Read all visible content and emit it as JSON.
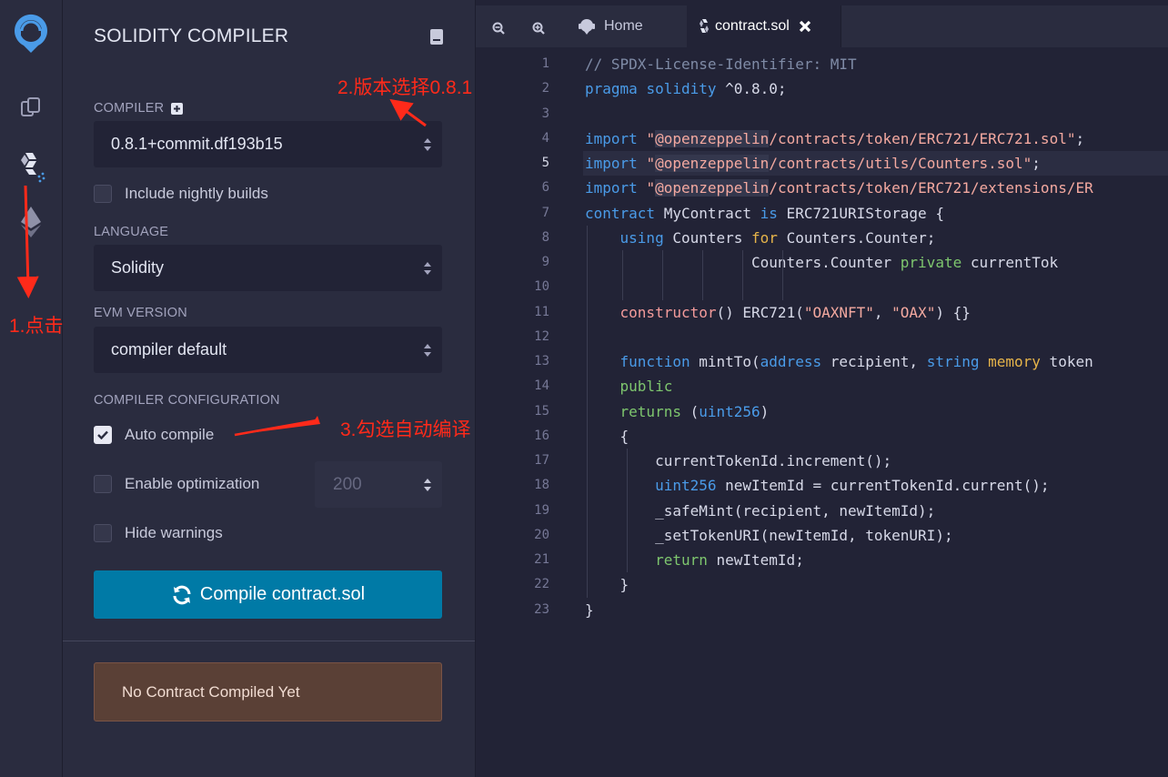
{
  "rail": {
    "icons": [
      "remix-logo-icon",
      "file-explorer-icon",
      "solidity-compiler-icon",
      "deploy-run-icon"
    ]
  },
  "panel": {
    "title": "SOLIDITY COMPILER",
    "compiler": {
      "label": "COMPILER",
      "value": "0.8.1+commit.df193b15"
    },
    "nightly_label": "Include nightly builds",
    "language": {
      "label": "LANGUAGE",
      "value": "Solidity"
    },
    "evm": {
      "label": "EVM VERSION",
      "value": "compiler default"
    },
    "config_label": "COMPILER CONFIGURATION",
    "auto_compile": {
      "label": "Auto compile",
      "checked": true
    },
    "optimization": {
      "label": "Enable optimization",
      "checked": false,
      "runs": "200"
    },
    "hide_warnings": {
      "label": "Hide warnings",
      "checked": false
    },
    "compile_button": "Compile contract.sol",
    "status": "No Contract Compiled Yet"
  },
  "annotations": {
    "step1": "1.点击",
    "step2": "2.版本选择0.8.1",
    "step3": "3.勾选自动编译"
  },
  "editor": {
    "tabs": [
      {
        "label": "Home",
        "active": false
      },
      {
        "label": "contract.sol",
        "active": true
      }
    ],
    "current_line": 5,
    "lines": [
      {
        "n": "1",
        "parts": [
          [
            "c-com",
            "// SPDX-License-Identifier: MIT"
          ]
        ]
      },
      {
        "n": "2",
        "parts": [
          [
            "c-kw",
            "pragma"
          ],
          [
            "",
            " "
          ],
          [
            "c-kw",
            "solidity"
          ],
          [
            "",
            " ^0.8.0;"
          ]
        ]
      },
      {
        "n": "3",
        "parts": []
      },
      {
        "n": "4",
        "parts": [
          [
            "c-kw",
            "import"
          ],
          [
            "",
            " "
          ],
          [
            "c-str",
            "\""
          ],
          [
            "c-str c-hl",
            "@openzeppelin"
          ],
          [
            "c-str",
            "/contracts/token/ERC721/ERC721.sol\""
          ],
          [
            "",
            ";"
          ]
        ]
      },
      {
        "n": "5",
        "parts": [
          [
            "c-kw",
            "import"
          ],
          [
            "",
            " "
          ],
          [
            "c-str",
            "\""
          ],
          [
            "c-str c-hl",
            "@openzeppelin"
          ],
          [
            "c-str",
            "/contracts/utils/Counters.sol\""
          ],
          [
            "",
            ";"
          ]
        ]
      },
      {
        "n": "6",
        "parts": [
          [
            "c-kw",
            "import"
          ],
          [
            "",
            " "
          ],
          [
            "c-str",
            "\""
          ],
          [
            "c-str c-hl",
            "@openzeppelin"
          ],
          [
            "c-str",
            "/contracts/token/ERC721/extensions/ER"
          ]
        ]
      },
      {
        "n": "7",
        "parts": [
          [
            "c-kw",
            "contract"
          ],
          [
            "",
            " MyContract "
          ],
          [
            "c-kw",
            "is"
          ],
          [
            "",
            " ERC721URIStorage {"
          ]
        ]
      },
      {
        "n": "8",
        "parts": [
          [
            "",
            "    "
          ],
          [
            "c-kw",
            "using"
          ],
          [
            "",
            " Counters "
          ],
          [
            "c-mem",
            "for"
          ],
          [
            "",
            " Counters.Counter;"
          ]
        ]
      },
      {
        "n": "9",
        "parts": [
          [
            "",
            "                   Counters.Counter "
          ],
          [
            "c-pv",
            "private"
          ],
          [
            "",
            " currentTok"
          ]
        ]
      },
      {
        "n": "10",
        "parts": []
      },
      {
        "n": "11",
        "parts": [
          [
            "",
            "    "
          ],
          [
            "c-fn",
            "constructor"
          ],
          [
            "",
            "() ERC721("
          ],
          [
            "c-str",
            "\"OAXNFT\""
          ],
          [
            "",
            ", "
          ],
          [
            "c-str",
            "\"OAX\""
          ],
          [
            "",
            ") {}"
          ]
        ]
      },
      {
        "n": "12",
        "parts": []
      },
      {
        "n": "13",
        "parts": [
          [
            "",
            "    "
          ],
          [
            "c-kw",
            "function"
          ],
          [
            "",
            " mintTo("
          ],
          [
            "c-kw",
            "address"
          ],
          [
            "",
            " recipient, "
          ],
          [
            "c-kw",
            "string"
          ],
          [
            "",
            " "
          ],
          [
            "c-mem",
            "memory"
          ],
          [
            "",
            " token"
          ]
        ]
      },
      {
        "n": "14",
        "parts": [
          [
            "",
            "    "
          ],
          [
            "c-pv",
            "public"
          ]
        ]
      },
      {
        "n": "15",
        "parts": [
          [
            "",
            "    "
          ],
          [
            "c-pv",
            "returns"
          ],
          [
            "",
            " ("
          ],
          [
            "c-kw",
            "uint256"
          ],
          [
            "",
            ")"
          ]
        ]
      },
      {
        "n": "16",
        "parts": [
          [
            "",
            "    {"
          ]
        ]
      },
      {
        "n": "17",
        "parts": [
          [
            "",
            "        currentTokenId.increment();"
          ]
        ]
      },
      {
        "n": "18",
        "parts": [
          [
            "",
            "        "
          ],
          [
            "c-kw",
            "uint256"
          ],
          [
            "",
            " newItemId = currentTokenId.current();"
          ]
        ]
      },
      {
        "n": "19",
        "parts": [
          [
            "",
            "        _safeMint(recipient, newItemId);"
          ]
        ]
      },
      {
        "n": "20",
        "parts": [
          [
            "",
            "        _setTokenURI(newItemId, tokenURI);"
          ]
        ]
      },
      {
        "n": "21",
        "parts": [
          [
            "",
            "        "
          ],
          [
            "c-pv",
            "return"
          ],
          [
            "",
            " newItemId;"
          ]
        ]
      },
      {
        "n": "22",
        "parts": [
          [
            "",
            "    }"
          ]
        ]
      },
      {
        "n": "23",
        "parts": [
          [
            "",
            "}"
          ]
        ]
      }
    ]
  },
  "colors": {
    "accent": "#007aa6",
    "annotation": "#ff2a1a",
    "status_bg": "#5a4036"
  }
}
